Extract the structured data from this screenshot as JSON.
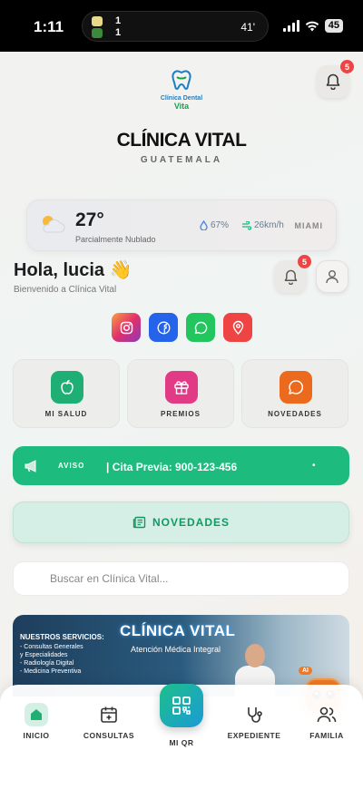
{
  "status_bar": {
    "time": "1:11",
    "score_home": "1",
    "score_away": "1",
    "match_minute": "41'",
    "battery": "45"
  },
  "header": {
    "logo_line1": "Clínica Dental",
    "logo_line2": "Vita",
    "title": "CLÍNICA VITAL",
    "country": "GUATEMALA",
    "notification_count": "5"
  },
  "weather": {
    "temperature": "27°",
    "description": "Parcialmente Nublado",
    "humidity": "67%",
    "wind": "26km/h",
    "city": "MIAMI"
  },
  "greeting": {
    "title": "Hola, lucia 👋",
    "subtitle": "Bienvenido a Clínica Vital",
    "notification_count": "5"
  },
  "social": [
    {
      "icon": "instagram-icon",
      "color": "#e1306c"
    },
    {
      "icon": "facebook-icon",
      "color": "#2563eb"
    },
    {
      "icon": "whatsapp-icon",
      "color": "#22c55e"
    },
    {
      "icon": "location-icon",
      "color": "#ef4444"
    }
  ],
  "tiles": [
    {
      "label": "MI SALUD",
      "icon": "apple-icon",
      "color": "#1fae74"
    },
    {
      "label": "PREMIOS",
      "icon": "gift-icon",
      "color": "#e13b86"
    },
    {
      "label": "NOVEDADES",
      "icon": "chat-bubble-icon",
      "color": "#ec6a1e"
    }
  ],
  "aviso": {
    "label": "AVISO",
    "text": "| Cita Previa: 900-123-456",
    "dot": "•"
  },
  "novedades_button": {
    "label": "NOVEDADES"
  },
  "search": {
    "placeholder": "Buscar en Clínica Vital..."
  },
  "banner": {
    "services_title": "NUESTROS SERVICIOS:",
    "services": [
      "- Consultas Generales",
      "  y Especialidades",
      "- Radiología Digital",
      "- Medicina Preventiva"
    ],
    "title": "CLÍNICA VITAL",
    "subtitle": "Atención Médica Integral"
  },
  "bottom_nav": {
    "items": [
      {
        "label": "INICIO",
        "icon": "home-icon",
        "active": true
      },
      {
        "label": "CONSULTAS",
        "icon": "calendar-plus-icon"
      },
      {
        "label": "MI QR",
        "icon": "qr-code-icon"
      },
      {
        "label": "EXPEDIENTE",
        "icon": "stethoscope-icon"
      },
      {
        "label": "FAMILIA",
        "icon": "users-icon"
      }
    ]
  },
  "ai_assistant": {
    "badge": "AI"
  }
}
